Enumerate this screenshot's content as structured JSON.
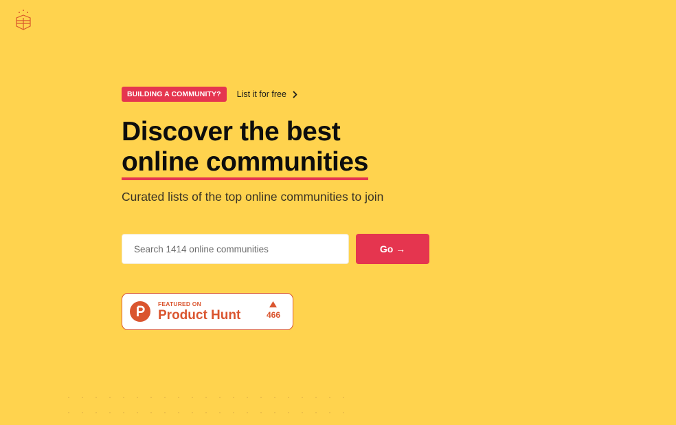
{
  "logo": {
    "icon": "honeycomb-logo-icon"
  },
  "announcement": {
    "badge": "BUILDING A COMMUNITY?",
    "link_label": "List it for free",
    "link_icon": "chevron-right-icon"
  },
  "hero": {
    "title_line1": "Discover the best",
    "title_line2": "online communities",
    "subtitle": "Curated lists of the top online communities to join"
  },
  "search": {
    "placeholder": "Search 1414 online communities",
    "value": "",
    "button_label": "Go →"
  },
  "product_hunt": {
    "featured_label": "FEATURED ON",
    "name": "Product Hunt",
    "votes": "466",
    "logo_icon": "product-hunt-logo-icon",
    "upvote_icon": "upvote-triangle-icon"
  },
  "colors": {
    "background": "#FFD34E",
    "accent": "#E5354F",
    "product_hunt": "#DA552F"
  }
}
